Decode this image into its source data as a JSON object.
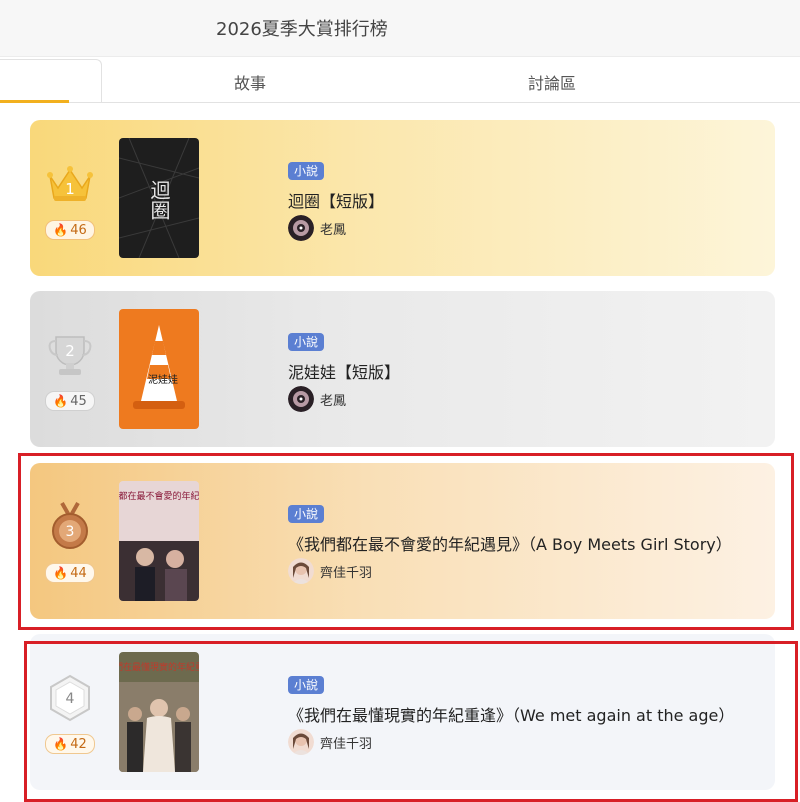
{
  "header": {
    "title": "2026夏季大賞排行榜"
  },
  "tabs": [
    {
      "label": ""
    },
    {
      "label": "故事"
    },
    {
      "label": "討論區"
    }
  ],
  "entries": [
    {
      "rank": "1",
      "heat": "46",
      "tag": "小說",
      "title": "迴圈【短版】",
      "author": "老鳳",
      "cover_text": "迴圈"
    },
    {
      "rank": "2",
      "heat": "45",
      "tag": "小說",
      "title": "泥娃娃【短版】",
      "author": "老鳳",
      "cover_text": "泥娃娃"
    },
    {
      "rank": "3",
      "heat": "44",
      "tag": "小說",
      "title": "《我們都在最不會愛的年紀遇見》（A Boy Meets Girl Story）",
      "author": "齊佳千羽",
      "cover_text": "我們都在最不會愛的年紀遇見"
    },
    {
      "rank": "4",
      "heat": "42",
      "tag": "小說",
      "title": "《我們在最懂現實的年紀重逢》（We met again at the age）",
      "author": "齊佳千羽",
      "cover_text": "我們在最懂現實的年紀重逢"
    }
  ],
  "colors": {
    "accent": "#f2b01e",
    "tag": "#5b7fd2",
    "highlight": "#d81f26"
  }
}
